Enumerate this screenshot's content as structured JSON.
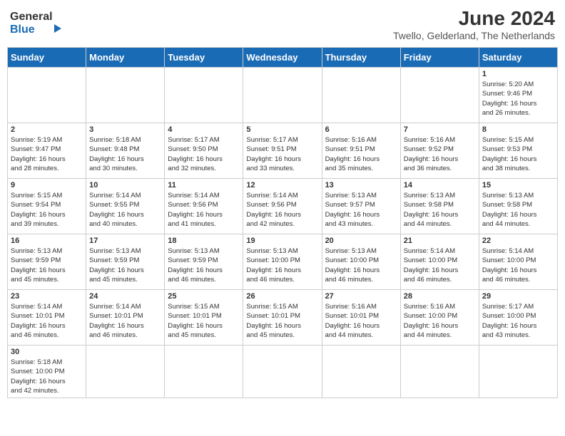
{
  "header": {
    "logo_line1": "General",
    "logo_line2": "Blue",
    "month_title": "June 2024",
    "subtitle": "Twello, Gelderland, The Netherlands"
  },
  "weekdays": [
    "Sunday",
    "Monday",
    "Tuesday",
    "Wednesday",
    "Thursday",
    "Friday",
    "Saturday"
  ],
  "weeks": [
    [
      {
        "day": "",
        "info": ""
      },
      {
        "day": "",
        "info": ""
      },
      {
        "day": "",
        "info": ""
      },
      {
        "day": "",
        "info": ""
      },
      {
        "day": "",
        "info": ""
      },
      {
        "day": "",
        "info": ""
      },
      {
        "day": "1",
        "info": "Sunrise: 5:20 AM\nSunset: 9:46 PM\nDaylight: 16 hours\nand 26 minutes."
      }
    ],
    [
      {
        "day": "2",
        "info": "Sunrise: 5:19 AM\nSunset: 9:47 PM\nDaylight: 16 hours\nand 28 minutes."
      },
      {
        "day": "3",
        "info": "Sunrise: 5:18 AM\nSunset: 9:48 PM\nDaylight: 16 hours\nand 30 minutes."
      },
      {
        "day": "4",
        "info": "Sunrise: 5:17 AM\nSunset: 9:50 PM\nDaylight: 16 hours\nand 32 minutes."
      },
      {
        "day": "5",
        "info": "Sunrise: 5:17 AM\nSunset: 9:51 PM\nDaylight: 16 hours\nand 33 minutes."
      },
      {
        "day": "6",
        "info": "Sunrise: 5:16 AM\nSunset: 9:51 PM\nDaylight: 16 hours\nand 35 minutes."
      },
      {
        "day": "7",
        "info": "Sunrise: 5:16 AM\nSunset: 9:52 PM\nDaylight: 16 hours\nand 36 minutes."
      },
      {
        "day": "8",
        "info": "Sunrise: 5:15 AM\nSunset: 9:53 PM\nDaylight: 16 hours\nand 38 minutes."
      }
    ],
    [
      {
        "day": "9",
        "info": "Sunrise: 5:15 AM\nSunset: 9:54 PM\nDaylight: 16 hours\nand 39 minutes."
      },
      {
        "day": "10",
        "info": "Sunrise: 5:14 AM\nSunset: 9:55 PM\nDaylight: 16 hours\nand 40 minutes."
      },
      {
        "day": "11",
        "info": "Sunrise: 5:14 AM\nSunset: 9:56 PM\nDaylight: 16 hours\nand 41 minutes."
      },
      {
        "day": "12",
        "info": "Sunrise: 5:14 AM\nSunset: 9:56 PM\nDaylight: 16 hours\nand 42 minutes."
      },
      {
        "day": "13",
        "info": "Sunrise: 5:13 AM\nSunset: 9:57 PM\nDaylight: 16 hours\nand 43 minutes."
      },
      {
        "day": "14",
        "info": "Sunrise: 5:13 AM\nSunset: 9:58 PM\nDaylight: 16 hours\nand 44 minutes."
      },
      {
        "day": "15",
        "info": "Sunrise: 5:13 AM\nSunset: 9:58 PM\nDaylight: 16 hours\nand 44 minutes."
      }
    ],
    [
      {
        "day": "16",
        "info": "Sunrise: 5:13 AM\nSunset: 9:59 PM\nDaylight: 16 hours\nand 45 minutes."
      },
      {
        "day": "17",
        "info": "Sunrise: 5:13 AM\nSunset: 9:59 PM\nDaylight: 16 hours\nand 45 minutes."
      },
      {
        "day": "18",
        "info": "Sunrise: 5:13 AM\nSunset: 9:59 PM\nDaylight: 16 hours\nand 46 minutes."
      },
      {
        "day": "19",
        "info": "Sunrise: 5:13 AM\nSunset: 10:00 PM\nDaylight: 16 hours\nand 46 minutes."
      },
      {
        "day": "20",
        "info": "Sunrise: 5:13 AM\nSunset: 10:00 PM\nDaylight: 16 hours\nand 46 minutes."
      },
      {
        "day": "21",
        "info": "Sunrise: 5:14 AM\nSunset: 10:00 PM\nDaylight: 16 hours\nand 46 minutes."
      },
      {
        "day": "22",
        "info": "Sunrise: 5:14 AM\nSunset: 10:00 PM\nDaylight: 16 hours\nand 46 minutes."
      }
    ],
    [
      {
        "day": "23",
        "info": "Sunrise: 5:14 AM\nSunset: 10:01 PM\nDaylight: 16 hours\nand 46 minutes."
      },
      {
        "day": "24",
        "info": "Sunrise: 5:14 AM\nSunset: 10:01 PM\nDaylight: 16 hours\nand 46 minutes."
      },
      {
        "day": "25",
        "info": "Sunrise: 5:15 AM\nSunset: 10:01 PM\nDaylight: 16 hours\nand 45 minutes."
      },
      {
        "day": "26",
        "info": "Sunrise: 5:15 AM\nSunset: 10:01 PM\nDaylight: 16 hours\nand 45 minutes."
      },
      {
        "day": "27",
        "info": "Sunrise: 5:16 AM\nSunset: 10:01 PM\nDaylight: 16 hours\nand 44 minutes."
      },
      {
        "day": "28",
        "info": "Sunrise: 5:16 AM\nSunset: 10:00 PM\nDaylight: 16 hours\nand 44 minutes."
      },
      {
        "day": "29",
        "info": "Sunrise: 5:17 AM\nSunset: 10:00 PM\nDaylight: 16 hours\nand 43 minutes."
      }
    ],
    [
      {
        "day": "30",
        "info": "Sunrise: 5:18 AM\nSunset: 10:00 PM\nDaylight: 16 hours\nand 42 minutes."
      },
      {
        "day": "",
        "info": ""
      },
      {
        "day": "",
        "info": ""
      },
      {
        "day": "",
        "info": ""
      },
      {
        "day": "",
        "info": ""
      },
      {
        "day": "",
        "info": ""
      },
      {
        "day": "",
        "info": ""
      }
    ]
  ]
}
